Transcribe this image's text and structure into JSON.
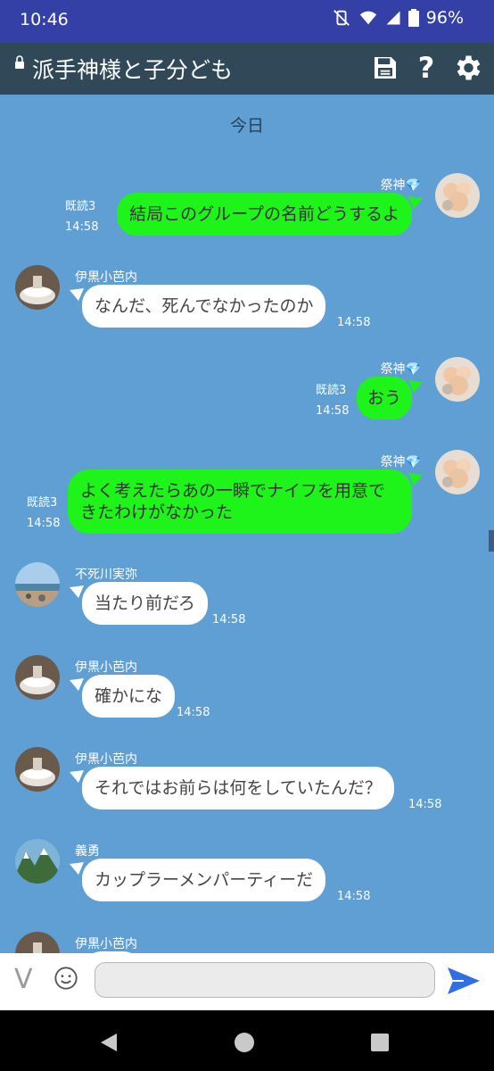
{
  "status": {
    "time": "10:46",
    "battery": "96%"
  },
  "header": {
    "title": "派手神様と子分ども",
    "save_icon": "save-icon",
    "help_label": "?",
    "settings_icon": "gear-icon"
  },
  "chat": {
    "date_label": "今日",
    "messages": [
      {
        "sender": "祭神💎",
        "text": "結局このグループの名前どうするよ",
        "time": "14:58",
        "read": "既読3",
        "direction": "out"
      },
      {
        "sender": "伊黒小芭内",
        "text": "なんだ、死んでなかったのか",
        "time": "14:58",
        "direction": "in"
      },
      {
        "sender": "祭神💎",
        "text": "おう",
        "time": "14:58",
        "read": "既読3",
        "direction": "out"
      },
      {
        "sender": "祭神💎",
        "text": "よく考えたらあの一瞬でナイフを用意できたわけがなかった",
        "time": "14:58",
        "read": "既読3",
        "direction": "out"
      },
      {
        "sender": "不死川実弥",
        "text": "当たり前だろ",
        "time": "14:58",
        "direction": "in"
      },
      {
        "sender": "伊黒小芭内",
        "text": "確かにな",
        "time": "14:58",
        "direction": "in"
      },
      {
        "sender": "伊黒小芭内",
        "text": "それではお前らは何をしていたんだ？",
        "time": "14:58",
        "direction": "in"
      },
      {
        "sender": "義勇",
        "text": "カップラーメンパーティーだ",
        "time": "14:58",
        "direction": "in"
      },
      {
        "sender": "伊黒小芭内",
        "text": "",
        "time": "",
        "direction": "in"
      }
    ]
  },
  "composer": {
    "v_label": "V",
    "emoji_icon": "smiley-icon",
    "placeholder": "",
    "send_icon": "send-icon"
  },
  "nav": {
    "back_icon": "back-icon",
    "home_icon": "home-icon",
    "recents_icon": "recents-icon"
  }
}
